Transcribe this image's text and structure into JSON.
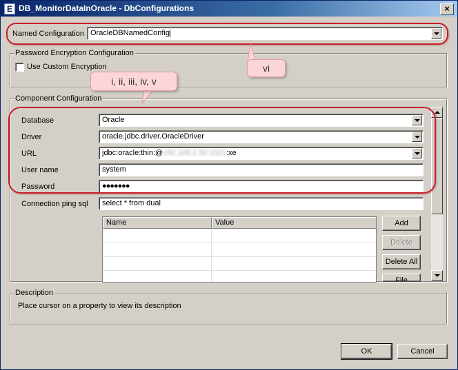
{
  "window": {
    "title": "DB_MonitorDataInOracle - DbConfigurations",
    "app_icon_glyph": "E",
    "close_glyph": "×"
  },
  "named_config": {
    "label": "Named Configuration",
    "value": "OracleDBNamedConfig"
  },
  "password_encryption": {
    "group_title": "Password Encryption Configuration",
    "checkbox_label": "Use Custom Encryption",
    "checked": false
  },
  "component": {
    "group_title": "Component Configuration",
    "database": {
      "label": "Database",
      "value": "Oracle"
    },
    "driver": {
      "label": "Driver",
      "value": "oracle.jdbc.driver.OracleDriver"
    },
    "url": {
      "label": "URL",
      "prefix": "jdbc:oracle:thin:@",
      "masked": "192.168.2.50:1521",
      "suffix": ":xe"
    },
    "username": {
      "label": "User name",
      "value": "system"
    },
    "password": {
      "label": "Password",
      "value": "●●●●●●●"
    },
    "ping_sql": {
      "label": "Connection ping sql",
      "value": "select * from dual"
    },
    "table": {
      "columns": [
        "Name",
        "Value"
      ]
    },
    "buttons": {
      "add": "Add",
      "delete": "Delete",
      "delete_all": "Delete All",
      "file": "File"
    }
  },
  "description": {
    "group_title": "Description",
    "text": "Place cursor on a property to view its description"
  },
  "footer": {
    "ok": "OK",
    "cancel": "Cancel"
  },
  "annotations": {
    "callout_vi": "vi",
    "callout_i_v": "i, ii, iii, iv, v",
    "ring_color": "#c8202a",
    "callout_color": "#fbd6d8"
  }
}
